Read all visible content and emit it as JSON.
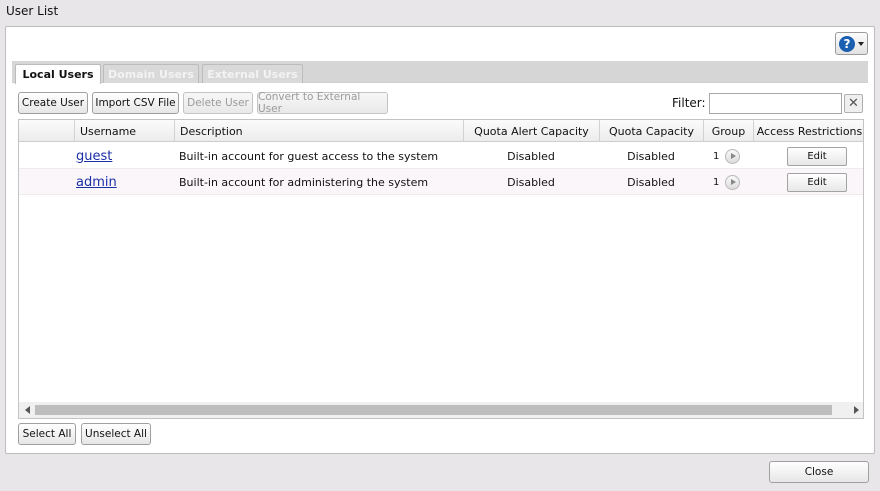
{
  "window": {
    "title": "User List"
  },
  "tabs": [
    {
      "label": "Local Users",
      "active": true
    },
    {
      "label": "Domain Users",
      "active": false
    },
    {
      "label": "External Users",
      "active": false
    }
  ],
  "toolbar": {
    "create_user": "Create User",
    "import_csv": "Import CSV File",
    "delete_user": "Delete User",
    "convert_external": "Convert to External User",
    "filter_label": "Filter:",
    "filter_value": "",
    "filter_clear": "✕"
  },
  "help": {
    "glyph": "?"
  },
  "table": {
    "columns": [
      "Username",
      "Description",
      "Quota Alert Capacity",
      "Quota Capacity",
      "Group",
      "Access Restrictions"
    ],
    "rows": [
      {
        "username": "guest",
        "description": "Built-in account for guest access to the system",
        "quota_alert": "Disabled",
        "quota": "Disabled",
        "group_count": "1",
        "access_button": "Edit"
      },
      {
        "username": "admin",
        "description": "Built-in account for administering the system",
        "quota_alert": "Disabled",
        "quota": "Disabled",
        "group_count": "1",
        "access_button": "Edit"
      }
    ]
  },
  "footer": {
    "select_all": "Select All",
    "unselect_all": "Unselect All",
    "close": "Close"
  },
  "colors": {
    "link": "#1b2fa6",
    "help_icon": "#1a5fb0",
    "background": "#e9e6e9"
  }
}
